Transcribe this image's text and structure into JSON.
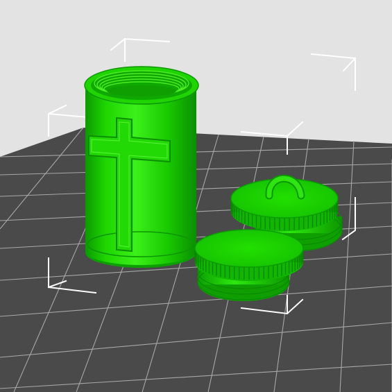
{
  "viewport": {
    "background": "#e3e3e3",
    "bed_color": "#4a4a4a",
    "grid_color": "#a8a8a8",
    "bounding_box_color": "#ffffff"
  },
  "objects": [
    {
      "name": "cross-canister",
      "color": "#19d400",
      "engraving": "cross"
    },
    {
      "name": "lid-with-loop",
      "color": "#19d400"
    },
    {
      "name": "screw-cap",
      "color": "#19d400"
    }
  ]
}
